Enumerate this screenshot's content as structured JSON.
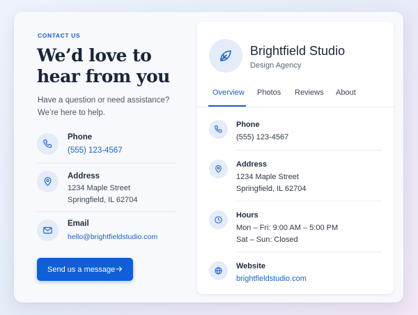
{
  "contact": {
    "eyebrow": "CONTACT US",
    "headline_line1": "We’d love to",
    "headline_line2": "hear from you",
    "intro_line1": "Have a question or need assistance?",
    "intro_line2": "We’re here to help.",
    "items": [
      {
        "label": "Phone",
        "lines": [
          "(555) 123-4567"
        ],
        "icon": "phone-icon"
      },
      {
        "label": "Address",
        "lines": [
          "1234 Maple Street",
          "Springfield, IL 62704"
        ],
        "icon": "map-pin-icon"
      },
      {
        "label": "Email",
        "lines": [
          "hello@brightfieldstudio.com"
        ],
        "icon": "mail-icon"
      }
    ],
    "cta_label": "Send us a message"
  },
  "business": {
    "name": "Brightfield Studio",
    "type": "Design Agency",
    "logo_icon": "leaf-icon",
    "tabs": [
      "Overview",
      "Photos",
      "Reviews",
      "About"
    ],
    "active_tab": "Overview",
    "details": [
      {
        "label": "Phone",
        "lines": [
          "(555) 123-4567"
        ],
        "icon": "phone-icon"
      },
      {
        "label": "Address",
        "lines": [
          "1234 Maple Street",
          "Springfield, IL 62704"
        ],
        "icon": "map-pin-icon"
      },
      {
        "label": "Hours",
        "lines": [
          "Mon – Fri: 9:00 AM – 5:00 PM",
          "Sat – Sun: Closed"
        ],
        "icon": "clock-icon"
      },
      {
        "label": "Website",
        "lines": [
          "brightfieldstudio.com"
        ],
        "icon": "globe-icon"
      }
    ]
  },
  "colors": {
    "accent": "#0f5fd7",
    "link": "#1a5fc7",
    "icon_bg": "#e3ecf8"
  }
}
